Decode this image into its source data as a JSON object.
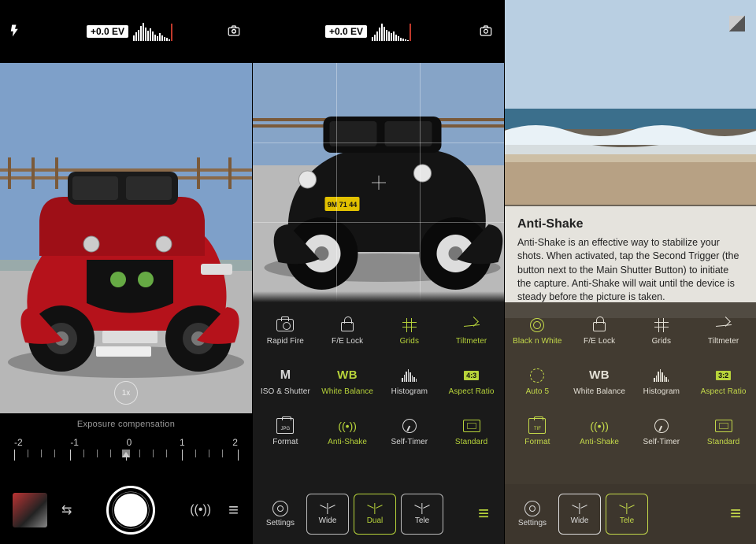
{
  "panel1": {
    "flash": "on",
    "ev_badge": "+0.0 EV",
    "zoom": "1x",
    "ec_label": "Exposure compensation",
    "ec_marks": [
      "-2",
      "-1",
      "0",
      "1",
      "2"
    ],
    "swap_icon": "camera-switch"
  },
  "panel2": {
    "ev_badge": "+0.0 EV",
    "menu": {
      "r1": [
        {
          "label": "Rapid Fire",
          "icon": "camera",
          "green": false
        },
        {
          "label": "F/E Lock",
          "icon": "lock",
          "green": false
        },
        {
          "label": "Grids",
          "icon": "grid",
          "green": true
        },
        {
          "label": "Tiltmeter",
          "icon": "tilt",
          "green": true
        }
      ],
      "r2": [
        {
          "label": "ISO & Shutter",
          "icon_text": "M",
          "green": false
        },
        {
          "label": "White Balance",
          "icon_text": "WB",
          "green": true
        },
        {
          "label": "Histogram",
          "icon": "hist",
          "green": false
        },
        {
          "label": "Aspect Ratio",
          "ratio": "4:3",
          "green": true
        }
      ],
      "r3": [
        {
          "label": "Format",
          "fmt": "JPG",
          "green": false
        },
        {
          "label": "Anti-Shake",
          "icon": "pulse",
          "green": true
        },
        {
          "label": "Self-Timer",
          "icon": "timer",
          "green": false
        },
        {
          "label": "Standard",
          "icon": "standard",
          "green": true
        }
      ]
    },
    "lenses": {
      "settings": "Settings",
      "wide": "Wide",
      "dual": "Dual",
      "tele": "Tele",
      "active": "Dual"
    }
  },
  "panel3": {
    "info": {
      "title": "Anti-Shake",
      "body": "Anti-Shake is an effective way to stabilize your shots. When activated, tap the Second Trigger (the button next to the Main Shutter Button) to initiate the capture. Anti-Shake will wait until the device is steady before the picture is taken."
    },
    "menu": {
      "r1": [
        {
          "label": "Black n White",
          "icon": "aperture",
          "green": true
        },
        {
          "label": "F/E Lock",
          "icon": "lock",
          "green": false
        },
        {
          "label": "Grids",
          "icon": "grid",
          "green": false
        },
        {
          "label": "Tiltmeter",
          "icon": "tilt",
          "green": false
        }
      ],
      "r2": [
        {
          "label": "Auto 5",
          "icon": "spin",
          "green": true
        },
        {
          "label": "White Balance",
          "icon_text": "WB",
          "green": false
        },
        {
          "label": "Histogram",
          "icon": "hist",
          "green": false
        },
        {
          "label": "Aspect Ratio",
          "ratio": "3:2",
          "green": true
        }
      ],
      "r3": [
        {
          "label": "Format",
          "fmt": "TIF",
          "green": true
        },
        {
          "label": "Anti-Shake",
          "icon": "pulse",
          "green": true
        },
        {
          "label": "Self-Timer",
          "icon": "timer",
          "green": false
        },
        {
          "label": "Standard",
          "icon": "standard",
          "green": true
        }
      ]
    },
    "lenses": {
      "settings": "Settings",
      "wide": "Wide",
      "tele": "Tele",
      "active": "Tele"
    }
  }
}
